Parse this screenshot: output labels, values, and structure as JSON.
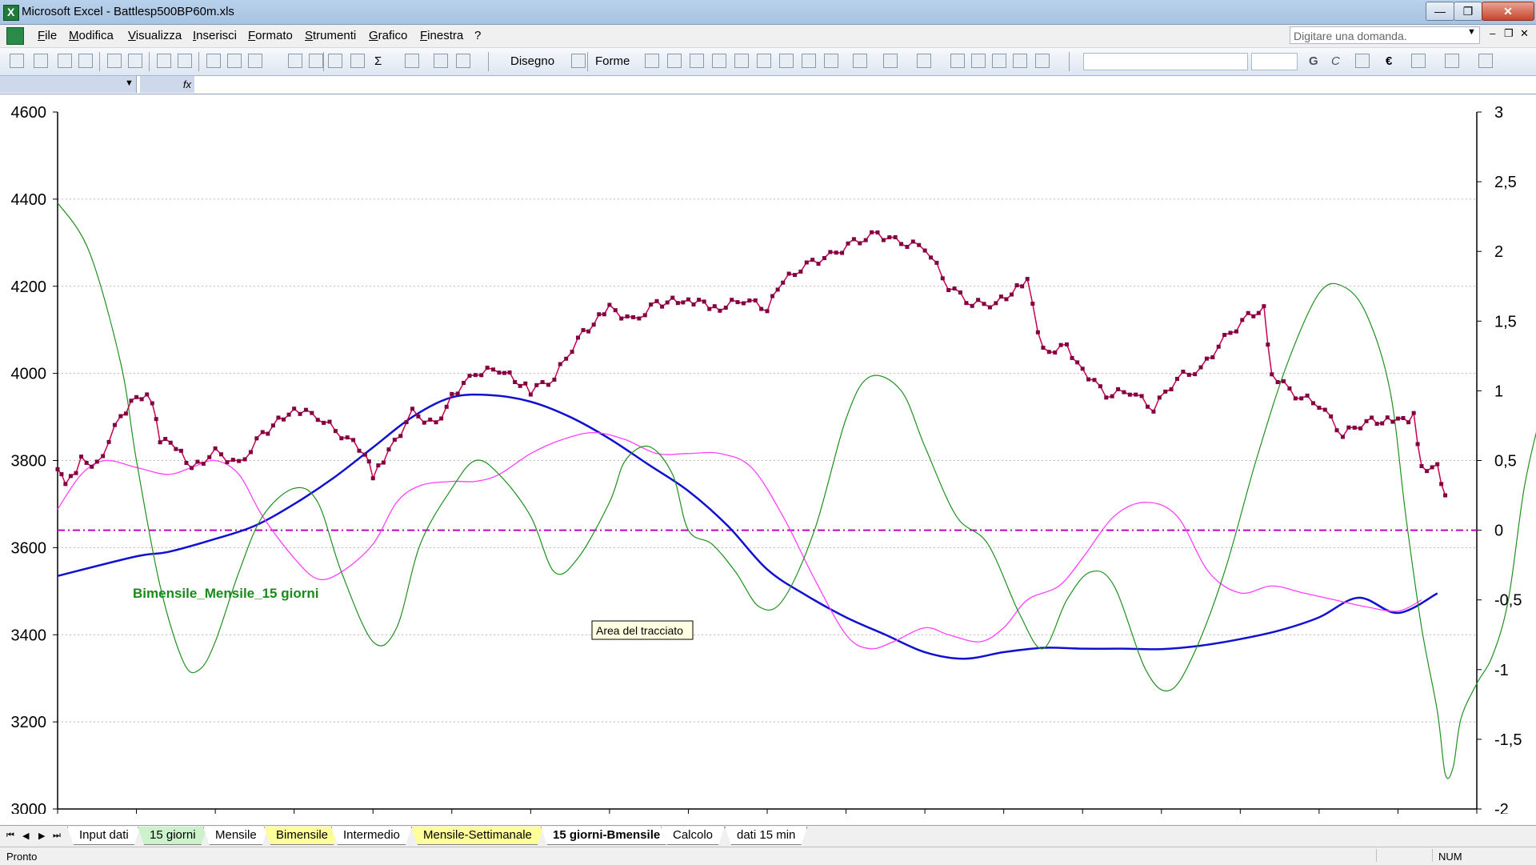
{
  "window": {
    "title": "Microsoft Excel - Battlesp500BP60m.xls",
    "btn_min": "—",
    "btn_max": "❐",
    "btn_close": "✕"
  },
  "menu": {
    "items": [
      "File",
      "Modifica",
      "Visualizza",
      "Inserisci",
      "Formato",
      "Strumenti",
      "Grafico",
      "Finestra",
      "?"
    ],
    "ask_placeholder": "Digitare una domanda."
  },
  "toolbar": {
    "draw_label": "Disegno",
    "shapes_label": "Forme",
    "bold_label": "G",
    "italic_label": "C",
    "euro_label": "€",
    "sigma_label": "Σ"
  },
  "formula": {
    "fx_label": "fx"
  },
  "chart_data": {
    "type": "line",
    "left_axis": {
      "min": 3000,
      "max": 4600,
      "ticks": [
        "4600",
        "4400",
        "4200",
        "4000",
        "3800",
        "3600",
        "3400",
        "3200",
        "3000"
      ]
    },
    "right_axis": {
      "min": -2,
      "max": 3,
      "ticks": [
        "3",
        "2,5",
        "2",
        "1,5",
        "1",
        "0,5",
        "0",
        "-0,5",
        "-1",
        "-1,5",
        "-2"
      ]
    },
    "x_categories": 18,
    "grid": true,
    "annotation": "Bimensile_Mensile_15 giorni",
    "tooltip": "Area del tracciato",
    "reference_line_right": 0,
    "colors": {
      "price": "#c80050",
      "price_marker": "#800040",
      "blue": "#1010d0",
      "magenta": "#ff40ff",
      "green": "#209020",
      "annotation": "#1a8a1a",
      "ref": "#c000c0"
    },
    "price_series": {
      "axis": "left",
      "points": [
        [
          0,
          3780
        ],
        [
          0.1,
          3740
        ],
        [
          0.3,
          3800
        ],
        [
          0.5,
          3790
        ],
        [
          0.8,
          3900
        ],
        [
          1.0,
          3950
        ],
        [
          1.2,
          3940
        ],
        [
          1.3,
          3850
        ],
        [
          1.5,
          3830
        ],
        [
          1.7,
          3780
        ],
        [
          2.0,
          3820
        ],
        [
          2.3,
          3790
        ],
        [
          2.6,
          3860
        ],
        [
          3.0,
          3920
        ],
        [
          3.3,
          3900
        ],
        [
          3.6,
          3860
        ],
        [
          3.9,
          3820
        ],
        [
          4.0,
          3760
        ],
        [
          4.2,
          3820
        ],
        [
          4.5,
          3910
        ],
        [
          4.8,
          3880
        ],
        [
          5.0,
          3950
        ],
        [
          5.3,
          4000
        ],
        [
          5.6,
          4010
        ],
        [
          6.0,
          3960
        ],
        [
          6.3,
          3990
        ],
        [
          6.6,
          4080
        ],
        [
          7.0,
          4150
        ],
        [
          7.3,
          4120
        ],
        [
          7.6,
          4160
        ],
        [
          8.0,
          4170
        ],
        [
          8.4,
          4150
        ],
        [
          8.7,
          4170
        ],
        [
          9.0,
          4150
        ],
        [
          9.2,
          4210
        ],
        [
          9.5,
          4250
        ],
        [
          9.8,
          4270
        ],
        [
          10.1,
          4300
        ],
        [
          10.4,
          4320
        ],
        [
          10.7,
          4300
        ],
        [
          11.0,
          4290
        ],
        [
          11.3,
          4200
        ],
        [
          11.6,
          4160
        ],
        [
          11.9,
          4160
        ],
        [
          12.3,
          4210
        ],
        [
          12.5,
          4050
        ],
        [
          12.8,
          4060
        ],
        [
          13.0,
          4010
        ],
        [
          13.3,
          3950
        ],
        [
          13.6,
          3960
        ],
        [
          13.9,
          3920
        ],
        [
          14.2,
          3990
        ],
        [
          14.5,
          4010
        ],
        [
          14.8,
          4080
        ],
        [
          15.1,
          4130
        ],
        [
          15.3,
          4150
        ],
        [
          15.4,
          4000
        ],
        [
          15.7,
          3950
        ],
        [
          16.0,
          3930
        ],
        [
          16.3,
          3860
        ],
        [
          16.6,
          3890
        ],
        [
          17.0,
          3890
        ],
        [
          17.2,
          3900
        ],
        [
          17.3,
          3780
        ],
        [
          17.5,
          3790
        ],
        [
          17.6,
          3720
        ]
      ]
    },
    "series": [
      {
        "key": "blue",
        "axis": "left",
        "points": [
          [
            0,
            3535
          ],
          [
            1.0,
            3580
          ],
          [
            1.4,
            3590
          ],
          [
            2.0,
            3620
          ],
          [
            2.5,
            3650
          ],
          [
            3.0,
            3700
          ],
          [
            3.5,
            3760
          ],
          [
            4.0,
            3830
          ],
          [
            4.5,
            3900
          ],
          [
            5.0,
            3945
          ],
          [
            5.5,
            3950
          ],
          [
            6.0,
            3935
          ],
          [
            6.5,
            3900
          ],
          [
            7.0,
            3850
          ],
          [
            7.5,
            3790
          ],
          [
            8.0,
            3730
          ],
          [
            8.5,
            3650
          ],
          [
            9.0,
            3550
          ],
          [
            9.5,
            3490
          ],
          [
            10.0,
            3440
          ],
          [
            10.5,
            3400
          ],
          [
            11.0,
            3360
          ],
          [
            11.5,
            3345
          ],
          [
            12.0,
            3360
          ],
          [
            12.5,
            3370
          ],
          [
            13.0,
            3368
          ],
          [
            13.5,
            3368
          ],
          [
            14.0,
            3367
          ],
          [
            14.5,
            3375
          ],
          [
            15.0,
            3390
          ],
          [
            15.5,
            3410
          ],
          [
            16.0,
            3440
          ],
          [
            16.5,
            3485
          ],
          [
            17.0,
            3450
          ],
          [
            17.5,
            3495
          ]
        ]
      },
      {
        "key": "magenta",
        "axis": "right",
        "points": [
          [
            0,
            0.15
          ],
          [
            0.3,
            0.4
          ],
          [
            0.6,
            0.5
          ],
          [
            1.0,
            0.45
          ],
          [
            1.4,
            0.4
          ],
          [
            1.7,
            0.45
          ],
          [
            2.0,
            0.5
          ],
          [
            2.3,
            0.4
          ],
          [
            2.6,
            0.1
          ],
          [
            3.0,
            -0.2
          ],
          [
            3.3,
            -0.35
          ],
          [
            3.6,
            -0.3
          ],
          [
            4.0,
            -0.1
          ],
          [
            4.3,
            0.2
          ],
          [
            4.6,
            0.32
          ],
          [
            5.0,
            0.35
          ],
          [
            5.3,
            0.35
          ],
          [
            5.6,
            0.4
          ],
          [
            6.0,
            0.55
          ],
          [
            6.4,
            0.65
          ],
          [
            6.8,
            0.7
          ],
          [
            7.2,
            0.65
          ],
          [
            7.6,
            0.55
          ],
          [
            8.0,
            0.55
          ],
          [
            8.4,
            0.55
          ],
          [
            8.8,
            0.45
          ],
          [
            9.2,
            0.1
          ],
          [
            9.6,
            -0.35
          ],
          [
            10.0,
            -0.75
          ],
          [
            10.3,
            -0.85
          ],
          [
            10.6,
            -0.8
          ],
          [
            11.0,
            -0.7
          ],
          [
            11.3,
            -0.75
          ],
          [
            11.7,
            -0.8
          ],
          [
            12.0,
            -0.7
          ],
          [
            12.3,
            -0.5
          ],
          [
            12.7,
            -0.4
          ],
          [
            13.0,
            -0.2
          ],
          [
            13.4,
            0.1
          ],
          [
            13.8,
            0.2
          ],
          [
            14.2,
            0.1
          ],
          [
            14.6,
            -0.3
          ],
          [
            15.0,
            -0.45
          ],
          [
            15.4,
            -0.4
          ],
          [
            15.8,
            -0.45
          ],
          [
            16.2,
            -0.5
          ],
          [
            16.6,
            -0.55
          ],
          [
            17.0,
            -0.58
          ],
          [
            17.3,
            -0.5
          ]
        ]
      },
      {
        "key": "green",
        "axis": "right",
        "points": [
          [
            0,
            2.35
          ],
          [
            0.4,
            2.0
          ],
          [
            0.8,
            1.2
          ],
          [
            1.0,
            0.5
          ],
          [
            1.3,
            -0.4
          ],
          [
            1.6,
            -0.95
          ],
          [
            1.8,
            -1.0
          ],
          [
            2.0,
            -0.8
          ],
          [
            2.3,
            -0.3
          ],
          [
            2.6,
            0.1
          ],
          [
            3.0,
            0.3
          ],
          [
            3.3,
            0.2
          ],
          [
            3.6,
            -0.3
          ],
          [
            4.0,
            -0.8
          ],
          [
            4.3,
            -0.7
          ],
          [
            4.6,
            -0.1
          ],
          [
            5.0,
            0.3
          ],
          [
            5.3,
            0.5
          ],
          [
            5.6,
            0.4
          ],
          [
            6.0,
            0.1
          ],
          [
            6.3,
            -0.3
          ],
          [
            6.6,
            -0.2
          ],
          [
            7.0,
            0.2
          ],
          [
            7.2,
            0.5
          ],
          [
            7.5,
            0.6
          ],
          [
            7.8,
            0.4
          ],
          [
            8.0,
            0.0
          ],
          [
            8.3,
            -0.1
          ],
          [
            8.6,
            -0.3
          ],
          [
            8.9,
            -0.55
          ],
          [
            9.2,
            -0.5
          ],
          [
            9.6,
            0.0
          ],
          [
            10.0,
            0.8
          ],
          [
            10.3,
            1.1
          ],
          [
            10.7,
            1.0
          ],
          [
            11.0,
            0.6
          ],
          [
            11.4,
            0.1
          ],
          [
            11.8,
            -0.1
          ],
          [
            12.2,
            -0.6
          ],
          [
            12.5,
            -0.85
          ],
          [
            12.8,
            -0.5
          ],
          [
            13.1,
            -0.3
          ],
          [
            13.4,
            -0.4
          ],
          [
            13.8,
            -1.0
          ],
          [
            14.1,
            -1.15
          ],
          [
            14.4,
            -0.9
          ],
          [
            14.8,
            -0.3
          ],
          [
            15.2,
            0.5
          ],
          [
            15.6,
            1.2
          ],
          [
            16.0,
            1.7
          ],
          [
            16.3,
            1.75
          ],
          [
            16.6,
            1.55
          ],
          [
            16.9,
            1.0
          ],
          [
            17.1,
            0.1
          ],
          [
            17.3,
            -0.7
          ],
          [
            17.5,
            -1.3
          ],
          [
            17.6,
            -1.75
          ],
          [
            17.7,
            -1.7
          ],
          [
            17.8,
            -1.35
          ],
          [
            18.0,
            -1.1
          ],
          [
            18.2,
            -0.9
          ],
          [
            18.4,
            -0.5
          ],
          [
            18.6,
            0.3
          ],
          [
            18.8,
            0.8
          ],
          [
            18.9,
            0.95
          ]
        ]
      }
    ]
  },
  "sheets": {
    "tabs": [
      {
        "label": "Input dati",
        "style": "plain"
      },
      {
        "label": "15 giorni",
        "style": "green"
      },
      {
        "label": "Mensile",
        "style": "plain"
      },
      {
        "label": "Bimensile",
        "style": "yellow"
      },
      {
        "label": "Intermedio",
        "style": "plain"
      },
      {
        "label": "Mensile-Settimanale",
        "style": "yellow"
      },
      {
        "label": "15 giorni-Bmensile",
        "style": "active"
      },
      {
        "label": "Calcolo",
        "style": "plain"
      },
      {
        "label": "dati 15 min",
        "style": "plain"
      }
    ]
  },
  "status": {
    "text": "Pronto",
    "num": "NUM"
  }
}
